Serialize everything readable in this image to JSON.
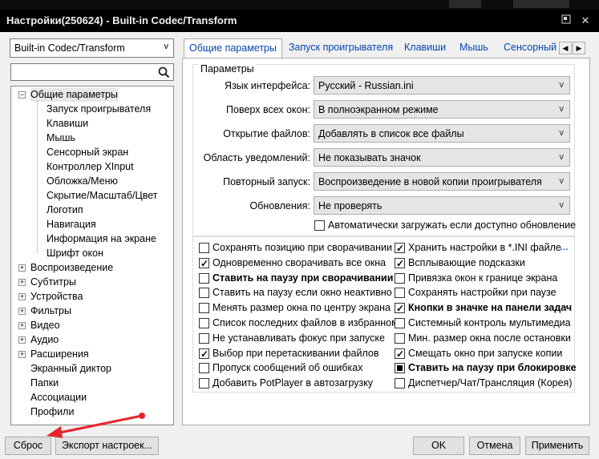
{
  "window": {
    "title": "Настройки(250624) - Built-in Codec/Transform",
    "pin_icon": "pin-icon",
    "close_icon": "close-icon"
  },
  "preset_select": {
    "value": "Built-in Codec/Transform"
  },
  "search": {
    "placeholder": ""
  },
  "tree": {
    "root_general": "Общие параметры",
    "children": [
      "Запуск проигрывателя",
      "Клавиши",
      "Мышь",
      "Сенсорный экран",
      "Контроллер XInput",
      "Обложка/Меню",
      "Скрытие/Масштаб/Цвет",
      "Логотип",
      "Навигация",
      "Информация на экране",
      "Шрифт окон"
    ],
    "sections": [
      "Воспроизведение",
      "Субтитры",
      "Устройства",
      "Фильтры",
      "Видео",
      "Аудио",
      "Расширения"
    ],
    "plain": [
      "Экранный диктор",
      "Папки",
      "Ассоциации",
      "Профили"
    ]
  },
  "tabs": [
    "Общие параметры",
    "Запуск проигрывателя",
    "Клавиши",
    "Мышь",
    "Сенсорный"
  ],
  "group_title": "Параметры",
  "fields": [
    {
      "label": "Язык интерфейса:",
      "value": "Русский - Russian.ini"
    },
    {
      "label": "Поверх всех окон:",
      "value": "В полноэкранном режиме"
    },
    {
      "label": "Открытие файлов:",
      "value": "Добавлять в список все файлы"
    },
    {
      "label": "Область уведомлений:",
      "value": "Не показывать значок"
    },
    {
      "label": "Повторный запуск:",
      "value": "Воспроизведение в новой копии проигрывателя"
    },
    {
      "label": "Обновления:",
      "value": "Не проверять"
    }
  ],
  "auto_update": {
    "label": "Автоматически загружать если доступно обновление",
    "checked": false
  },
  "options_left": [
    {
      "label": "Сохранять позицию при сворачивании",
      "checked": false,
      "bold": false
    },
    {
      "label": "Одновременно сворачивать все окна",
      "checked": true,
      "bold": false
    },
    {
      "label": "Ставить на паузу при сворачивании",
      "checked": false,
      "bold": true
    },
    {
      "label": "Ставить на паузу если окно неактивно",
      "checked": false,
      "bold": false
    },
    {
      "label": "Менять размер окна по центру экрана",
      "checked": false,
      "bold": false
    },
    {
      "label": "Список последних файлов в избранном",
      "checked": false,
      "bold": false
    },
    {
      "label": "Не устанавливать фокус при запуске",
      "checked": false,
      "bold": false
    },
    {
      "label": "Выбор при перетаскивании файлов",
      "checked": true,
      "bold": false
    },
    {
      "label": "Пропуск сообщений об ошибках",
      "checked": false,
      "bold": false
    },
    {
      "label": "Добавить PotPlayer в автозагрузку",
      "checked": false,
      "bold": false
    }
  ],
  "options_right": [
    {
      "label": "Хранить настройки в *.INI файле",
      "checked": true,
      "bold": false
    },
    {
      "label": "Всплывающие подсказки",
      "checked": true,
      "bold": false
    },
    {
      "label": "Привязка окон к границе экрана",
      "checked": false,
      "bold": false
    },
    {
      "label": "Сохранять настройки при паузе",
      "checked": false,
      "bold": false
    },
    {
      "label": "Кнопки в значке на панели задач",
      "checked": true,
      "bold": true
    },
    {
      "label": "Системный контроль мультимедиа",
      "checked": false,
      "bold": false
    },
    {
      "label": "Мин. размер окна после остановки",
      "checked": false,
      "bold": false
    },
    {
      "label": "Смещать окно при запуске копии",
      "checked": true,
      "bold": false
    },
    {
      "label": "Ставить на паузу при блокировке",
      "checked": "partial",
      "bold": true
    },
    {
      "label": "Диспетчер/Чат/Трансляция (Корея)",
      "checked": false,
      "bold": false
    }
  ],
  "more_dots": "…",
  "buttons": {
    "reset": "Сброс",
    "export": "Экспорт настроек...",
    "ok": "OK",
    "cancel": "Отмена",
    "apply": "Применить"
  },
  "colors": {
    "annotation_arrow": "#e8252b",
    "tab_text": "#0645ad",
    "titlebar": "#000000"
  }
}
